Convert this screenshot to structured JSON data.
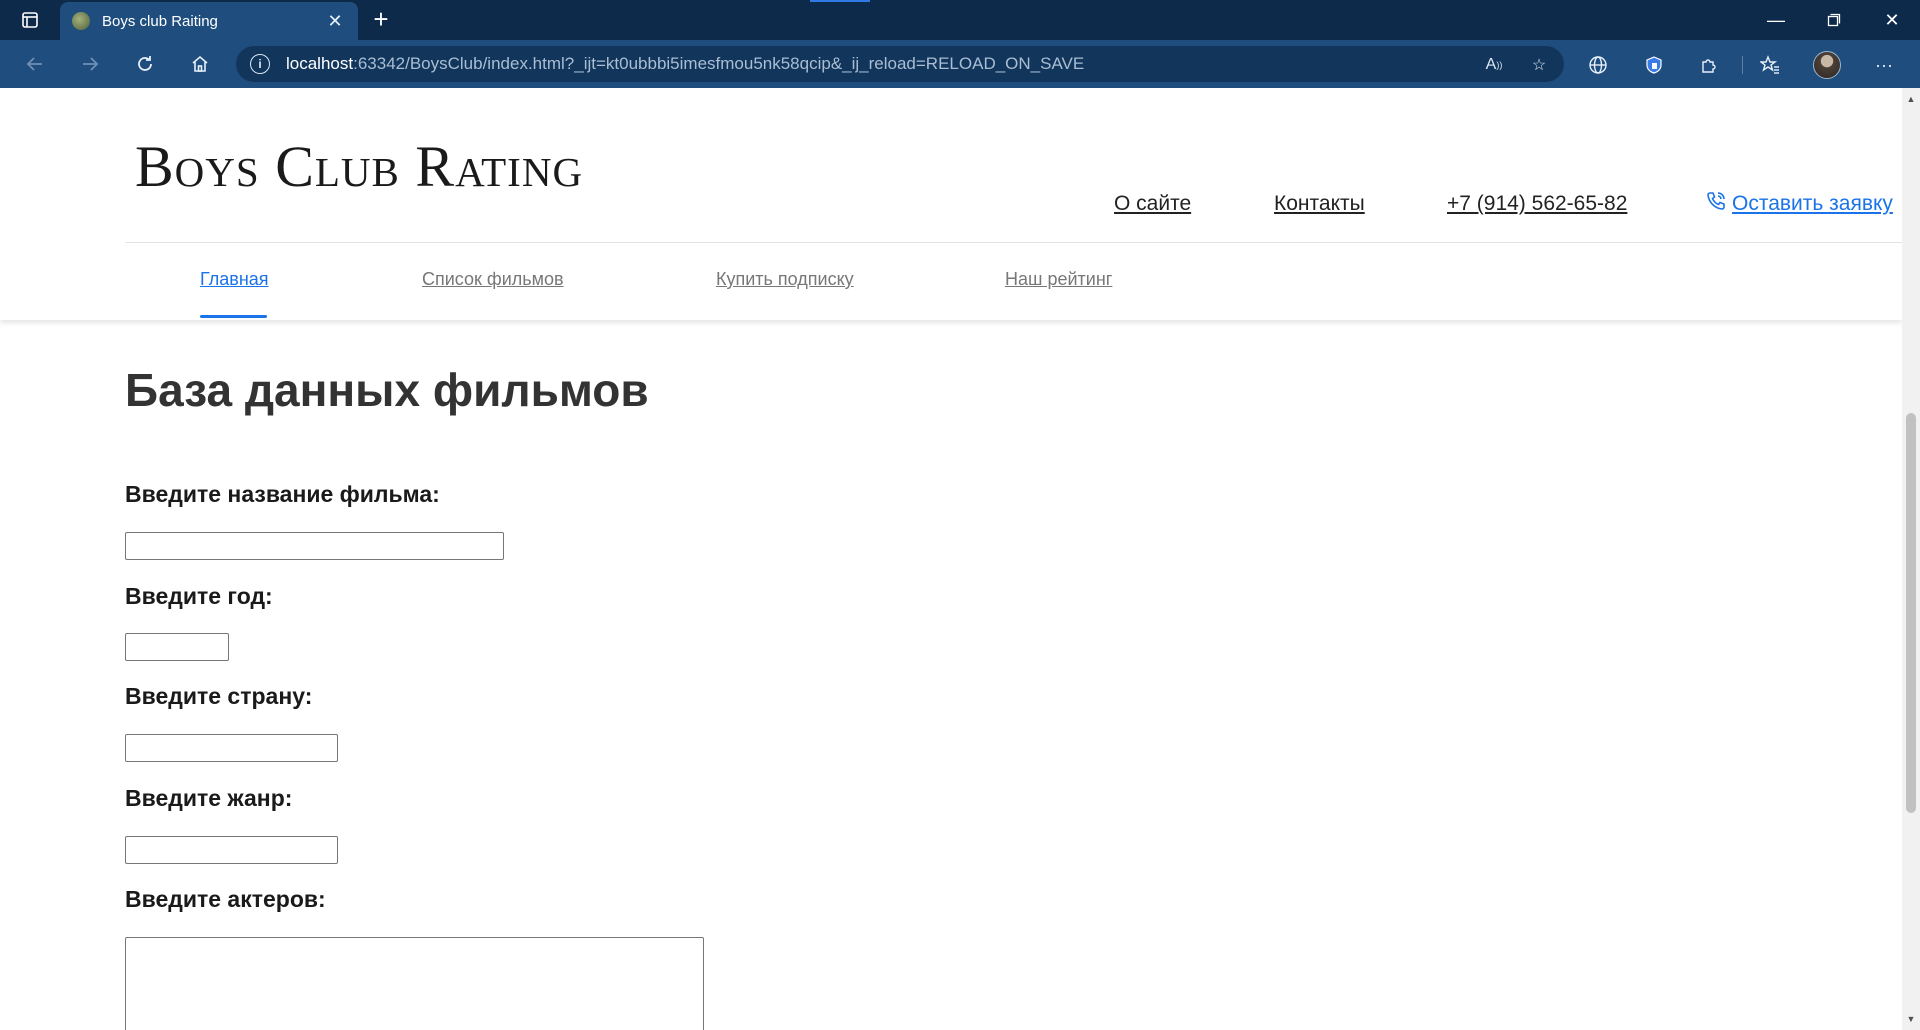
{
  "browser": {
    "tab_title": "Boys club Raiting",
    "url_host": "localhost",
    "url_rest": ":63342/BoysClub/index.html?_ijt=kt0ubbbi5imesfmou5nk58qcip&_ij_reload=RELOAD_ON_SAVE"
  },
  "site": {
    "logo": "Boys Club Rating",
    "top_links": {
      "about": "О сайте",
      "contacts": "Контакты",
      "phone": "+7 (914) 562-65-82",
      "request": "Оставить заявку"
    },
    "menu": {
      "home": "Главная",
      "films": "Список фильмов",
      "subscription": "Купить подписку",
      "rating": "Наш рейтинг"
    }
  },
  "form": {
    "title": "База данных фильмов",
    "film_name_label": "Введите название фильма:",
    "year_label": "Введите год:",
    "country_label": "Введите страну:",
    "genre_label": "Введите жанр:",
    "actors_label": "Введите актеров:",
    "film_name_value": "",
    "year_value": "",
    "country_value": "",
    "genre_value": "",
    "actors_value": ""
  }
}
